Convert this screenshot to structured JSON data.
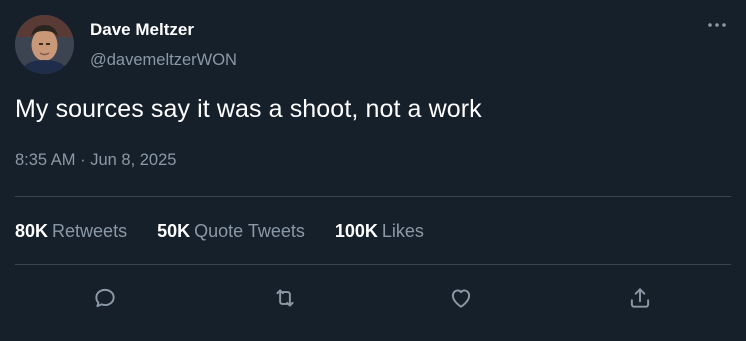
{
  "author": {
    "display_name": "Dave Meltzer",
    "handle": "@davemeltzerWON",
    "avatar_icon": "profile-photo"
  },
  "tweet": {
    "text": "My sources say it was a shoot, not a work",
    "timestamp": "8:35 AM · Jun 8, 2025"
  },
  "stats": {
    "retweets": {
      "count": "80K",
      "label": "Retweets"
    },
    "quote_tweets": {
      "count": "50K",
      "label": "Quote Tweets"
    },
    "likes": {
      "count": "100K",
      "label": "Likes"
    }
  },
  "actions": {
    "reply_icon": "reply-icon",
    "retweet_icon": "retweet-icon",
    "like_icon": "heart-icon",
    "share_icon": "share-icon"
  },
  "colors": {
    "background": "#15202b",
    "primary_text": "#ffffff",
    "secondary_text": "#8b98a5",
    "divider": "#38444d"
  }
}
